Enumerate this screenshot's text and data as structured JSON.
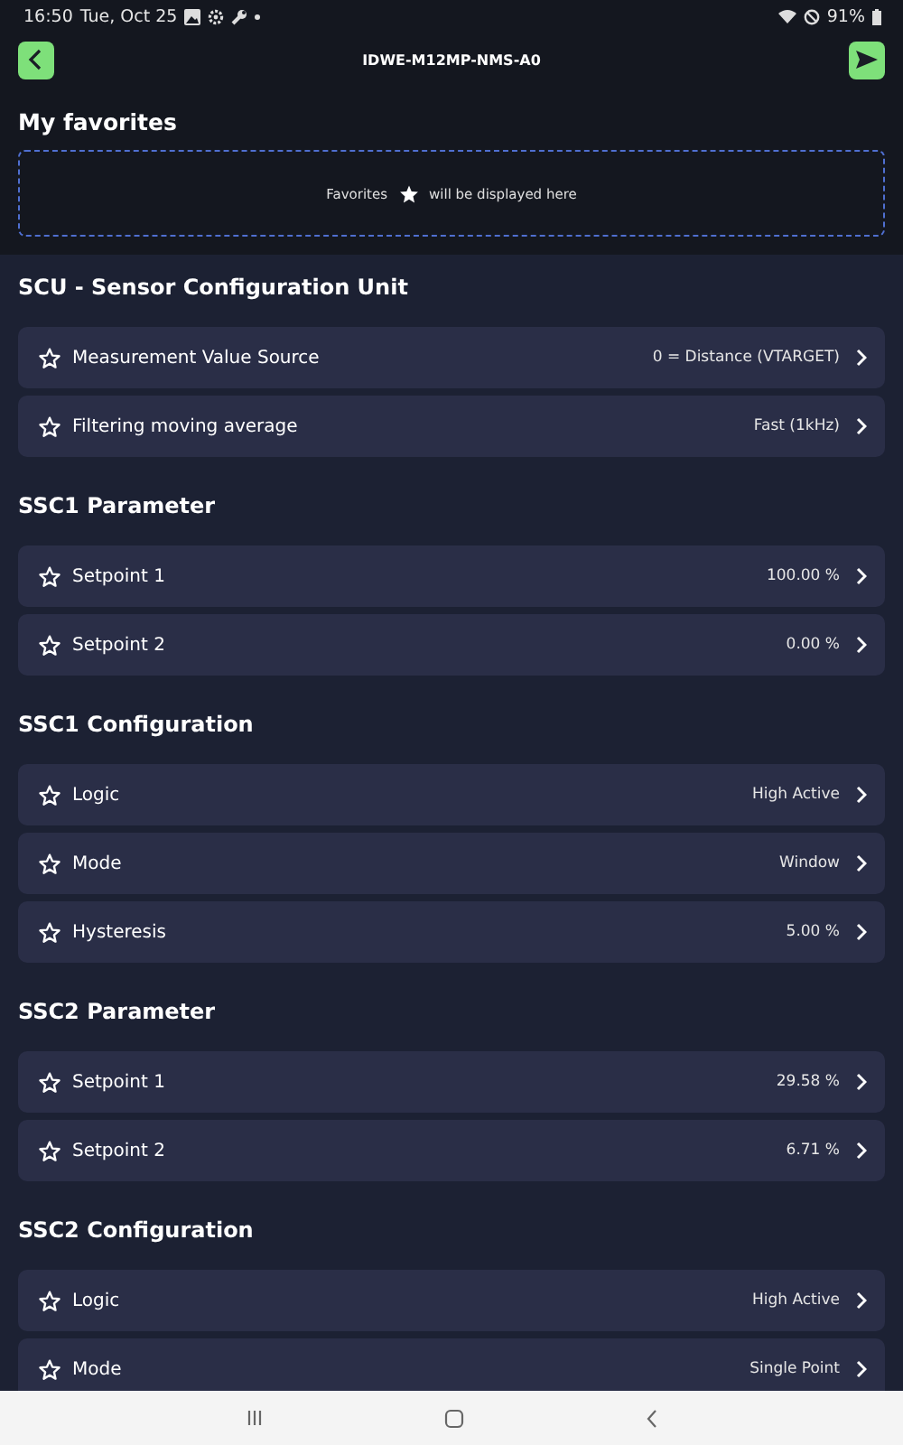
{
  "status_bar": {
    "time": "16:50",
    "date": "Tue, Oct 25",
    "battery": "91%"
  },
  "header": {
    "title": "IDWE-M12MP-NMS-A0"
  },
  "favorites": {
    "title": "My favorites",
    "hint_before": "Favorites",
    "hint_after": "will be displayed here"
  },
  "sections": [
    {
      "title": "SCU - Sensor Configuration Unit",
      "rows": [
        {
          "label": "Measurement Value Source",
          "value": "0 = Distance (VTARGET)",
          "favorite": false
        },
        {
          "label": "Filtering moving average",
          "value": "Fast (1kHz)",
          "favorite": false
        }
      ]
    },
    {
      "title": "SSC1 Parameter",
      "rows": [
        {
          "label": "Setpoint 1",
          "value": "100.00 %",
          "favorite": false
        },
        {
          "label": "Setpoint 2",
          "value": "0.00 %",
          "favorite": false
        }
      ]
    },
    {
      "title": "SSC1 Configuration",
      "rows": [
        {
          "label": "Logic",
          "value": "High Active",
          "favorite": false
        },
        {
          "label": "Mode",
          "value": "Window",
          "favorite": false
        },
        {
          "label": "Hysteresis",
          "value": "5.00 %",
          "favorite": false
        }
      ]
    },
    {
      "title": "SSC2 Parameter",
      "rows": [
        {
          "label": "Setpoint 1",
          "value": "29.58 %",
          "favorite": false
        },
        {
          "label": "Setpoint 2",
          "value": "6.71 %",
          "favorite": false
        }
      ]
    },
    {
      "title": "SSC2 Configuration",
      "rows": [
        {
          "label": "Logic",
          "value": "High Active",
          "favorite": false
        },
        {
          "label": "Mode",
          "value": "Single Point",
          "favorite": false
        }
      ]
    }
  ]
}
